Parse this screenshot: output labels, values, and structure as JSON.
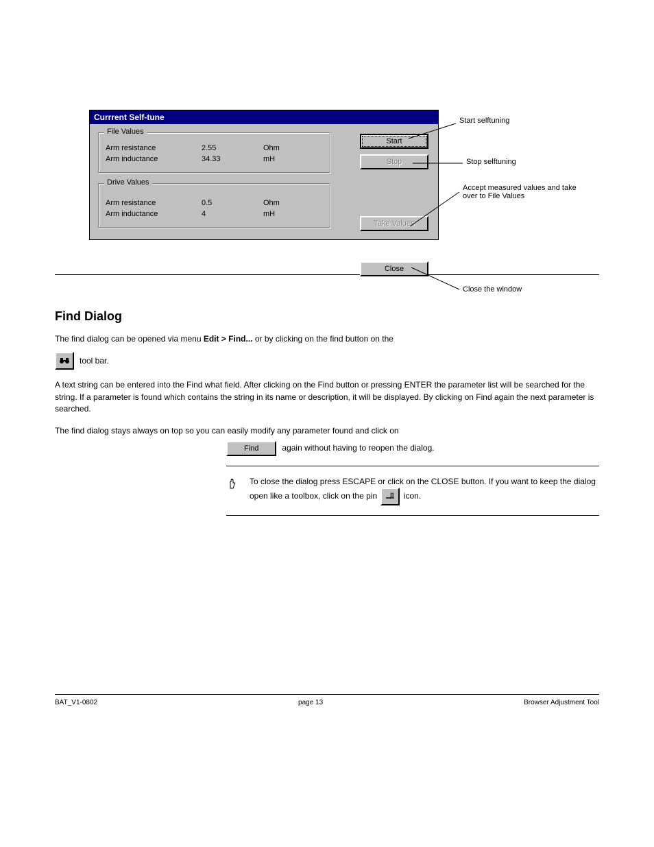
{
  "dialog": {
    "title": "Currrent Self-tune",
    "fileValues": {
      "legend": "File Values",
      "rows": [
        {
          "label": "Arm resistance",
          "value": "2.55",
          "unit": "Ohm"
        },
        {
          "label": "Arm inductance",
          "value": "34.33",
          "unit": "mH"
        }
      ]
    },
    "driveValues": {
      "legend": "Drive Values",
      "rows": [
        {
          "label": "Arm resistance",
          "value": "0.5",
          "unit": "Ohm"
        },
        {
          "label": "Arm inductance",
          "value": "4",
          "unit": "mH"
        }
      ]
    },
    "buttons": {
      "start": "Start",
      "stop": "Stop",
      "take": "Take Values",
      "close": "Close"
    }
  },
  "callouts": {
    "start": "Start selftuning",
    "stop": "Stop selftuning",
    "take": "Accept measured values and take over to File Values",
    "close": "Close the window"
  },
  "section": {
    "heading": "Find Dialog",
    "line1_pre": "The find dialog can be opened via menu ",
    "line1_menu": "Edit > Find...",
    "line1_post": " or by clicking on the find button on the",
    "line2": "tool bar.",
    "para2": "A text string can be entered into the Find what field. After clicking on the Find button or pressing ENTER the parameter list will be searched for the string. If a parameter is found which contains the string in its name or description, it will be displayed. By clicking on Find again the next parameter is searched.",
    "para3_pre": "The find dialog stays always on top so you can easily modify any parameter found and click on",
    "para3_post": " again without having to reopen the dialog.",
    "find_label": "Find",
    "tip_pre": "To close the dialog press ESCAPE or click on the CLOSE button. If you want to keep the dialog open like a toolbox, click on the pin ",
    "tip_post": " icon."
  },
  "footer": {
    "left": "BAT_V1-0802",
    "center": "page 13",
    "right": "Browser Adjustment Tool"
  }
}
